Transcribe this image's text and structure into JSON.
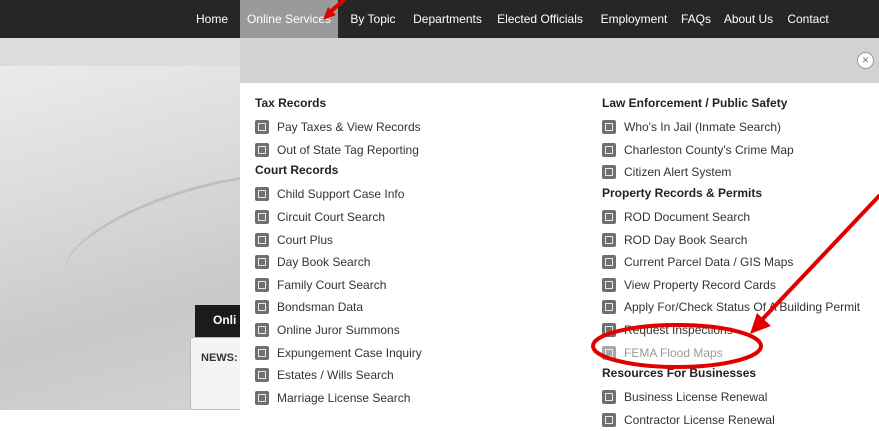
{
  "nav": {
    "items": [
      "Home",
      "Online Services",
      "By Topic",
      "Departments",
      "Elected Officials",
      "Employment",
      "FAQs",
      "About Us",
      "Contact"
    ],
    "active": "Online Services"
  },
  "background": {
    "tab_label": "Onli",
    "news_label": "NEWS:"
  },
  "menu": {
    "left": [
      {
        "heading": "Tax Records",
        "links": [
          {
            "label": "Pay Taxes & View Records",
            "icon": "calculator-icon"
          },
          {
            "label": "Out of State Tag Reporting",
            "icon": "license-plate-icon"
          }
        ]
      },
      {
        "heading": "Court Records",
        "links": [
          {
            "label": "Child Support Case Info",
            "icon": "family-icon"
          },
          {
            "label": "Circuit Court Search",
            "icon": "person-search-icon"
          },
          {
            "label": "Court Plus",
            "icon": "court-plus-icon"
          },
          {
            "label": "Day Book Search",
            "icon": "book-icon"
          },
          {
            "label": "Family Court Search",
            "icon": "family-court-icon"
          },
          {
            "label": "Bondsman Data",
            "icon": "data-icon"
          },
          {
            "label": "Online Juror Summons",
            "icon": "juror-icon"
          },
          {
            "label": "Expungement Case Inquiry",
            "icon": "question-icon"
          },
          {
            "label": "Estates / Wills Search",
            "icon": "estate-icon"
          },
          {
            "label": "Marriage License Search",
            "icon": "marriage-icon"
          }
        ]
      }
    ],
    "right": [
      {
        "heading": "Law Enforcement / Public Safety",
        "links": [
          {
            "label": "Who's In Jail (Inmate Search)",
            "icon": "jail-icon"
          },
          {
            "label": "Charleston County's Crime Map",
            "icon": "crime-map-icon"
          },
          {
            "label": "Citizen Alert System",
            "icon": "alert-icon"
          }
        ]
      },
      {
        "heading": "Property Records & Permits",
        "links": [
          {
            "label": "ROD Document Search",
            "icon": "document-icon"
          },
          {
            "label": "ROD Day Book Search",
            "icon": "book-icon"
          },
          {
            "label": "Current Parcel Data / GIS Maps",
            "icon": "map-icon"
          },
          {
            "label": "View Property Record Cards",
            "icon": "house-icon"
          },
          {
            "label": "Apply For/Check Status Of A Building Permit",
            "icon": "permit-icon"
          },
          {
            "label": "Request Inspections",
            "icon": "inspection-icon"
          },
          {
            "label": "FEMA Flood Maps",
            "icon": "flood-map-icon"
          }
        ]
      },
      {
        "heading": "Resources For Businesses",
        "links": [
          {
            "label": "Business License Renewal",
            "icon": "business-icon"
          },
          {
            "label": "Contractor License Renewal",
            "icon": "contractor-icon"
          }
        ]
      }
    ]
  },
  "annotation": {
    "color": "#e00000",
    "highlighted_item": "FEMA Flood Maps"
  }
}
